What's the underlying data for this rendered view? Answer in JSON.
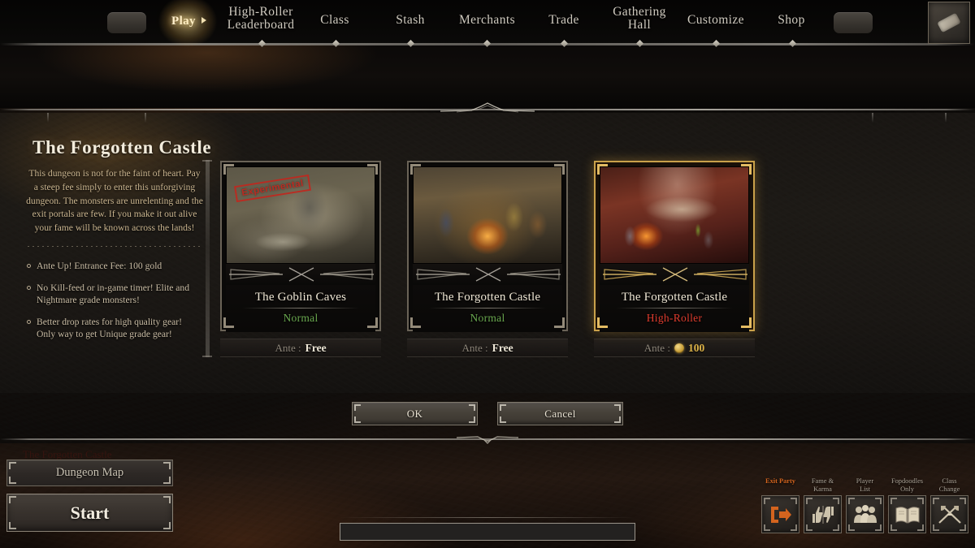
{
  "nav": {
    "items": [
      {
        "label": "Play",
        "active": true,
        "icon": "play-glow-icon"
      },
      {
        "label": "High-Roller\nLeaderboard",
        "active": false
      },
      {
        "label": "Class",
        "active": false
      },
      {
        "label": "Stash",
        "active": false
      },
      {
        "label": "Merchants",
        "active": false
      },
      {
        "label": "Trade",
        "active": false
      },
      {
        "label": "Gathering\nHall",
        "active": false
      },
      {
        "label": "Customize",
        "active": false
      },
      {
        "label": "Shop",
        "active": false
      }
    ],
    "left_pill_icon": "nav-pill-left",
    "right_pill_icon": "nav-pill-right",
    "book_icon": "scroll-book-icon"
  },
  "page": {
    "title": "The Forgotten Castle",
    "description": "This dungeon is not for the faint of heart. Pay a steep fee simply to enter this unforgiving dungeon. The monsters are unrelenting and the exit portals are few. If you make it out alive your fame will be known across the lands!",
    "bullets": [
      "Ante Up! Entrance Fee: 100 gold",
      "No Kill-feed or in-game timer! Elite and Nightmare grade monsters!",
      "Better drop rates for high quality gear!\nOnly way to get Unique grade gear!"
    ]
  },
  "cards": [
    {
      "title": "The Goblin Caves",
      "mode": "Normal",
      "mode_color": "#6aa84f",
      "ante_label": "Ante :",
      "ante_value": "Free",
      "ante_is_gold": false,
      "selected": false,
      "stamp": "Experimental",
      "stamp_color": "#c0281f",
      "art": "art-goblin"
    },
    {
      "title": "The Forgotten Castle",
      "mode": "Normal",
      "mode_color": "#6aa84f",
      "ante_label": "Ante :",
      "ante_value": "Free",
      "ante_is_gold": false,
      "selected": false,
      "stamp": "",
      "art": "art-castle"
    },
    {
      "title": "The Forgotten Castle",
      "mode": "High-Roller",
      "mode_color": "#e03c2e",
      "ante_label": "Ante :",
      "ante_value": "100",
      "ante_is_gold": true,
      "selected": true,
      "stamp": "",
      "art": "art-hr"
    }
  ],
  "dialog": {
    "ok_label": "OK",
    "cancel_label": "Cancel"
  },
  "hud": {
    "faded_party_label": "The Forgotten Castle",
    "map_button": "Dungeon Map",
    "start_button": "Start",
    "chat_placeholder": "",
    "chat_value": "",
    "icons": [
      {
        "label": "Exit Party",
        "icon": "exit-arrow-icon",
        "accent": "#d4641e"
      },
      {
        "label": "Fame &\nKarma",
        "icon": "thumbs-up-down-icon"
      },
      {
        "label": "Player\nList",
        "icon": "player-list-icon"
      },
      {
        "label": "Fopdoodles\nOnly",
        "icon": "open-book-icon"
      },
      {
        "label": "Class\nChange",
        "icon": "crossed-weapons-icon"
      }
    ]
  },
  "colors": {
    "gold_accent": "#c9a14a",
    "normal_green": "#6aa84f",
    "highroller_red": "#e03c2e",
    "exit_orange": "#d4641e",
    "body_text": "#cbb690"
  }
}
